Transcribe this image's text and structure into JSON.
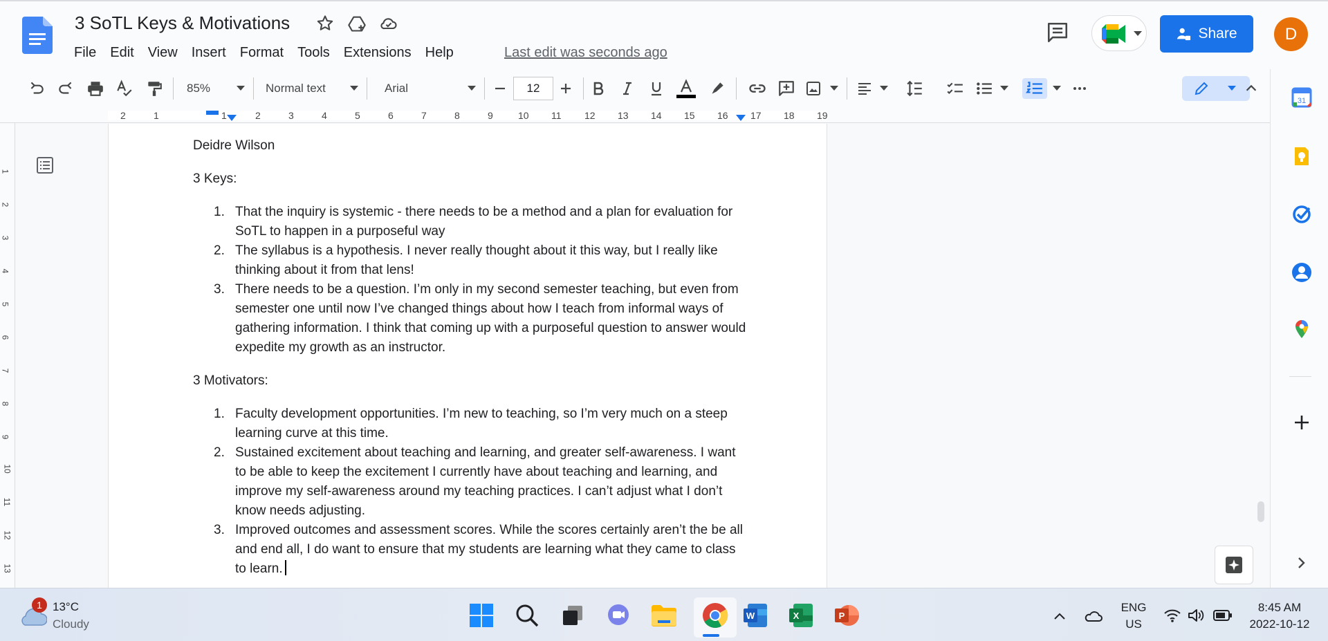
{
  "app": {
    "title": "3 SoTL Keys & Motivations",
    "menu": [
      "File",
      "Edit",
      "View",
      "Insert",
      "Format",
      "Tools",
      "Extensions",
      "Help"
    ],
    "last_edit": "Last edit was seconds ago",
    "share_label": "Share",
    "avatar_initial": "D"
  },
  "toolbar": {
    "zoom": "85%",
    "style": "Normal text",
    "font": "Arial",
    "font_size": "12"
  },
  "ruler": {
    "top_numbers": [
      "2",
      "1",
      "1",
      "2",
      "3",
      "4",
      "5",
      "6",
      "7",
      "8",
      "9",
      "10",
      "11",
      "12",
      "13",
      "14",
      "15",
      "16",
      "17",
      "18",
      "19"
    ],
    "left_numbers": [
      "1",
      "2",
      "3",
      "4",
      "5",
      "6",
      "7",
      "8",
      "9",
      "10",
      "11",
      "12",
      "13"
    ]
  },
  "document": {
    "author": "Deidre Wilson",
    "keys_heading": "3 Keys:",
    "keys": [
      "That the inquiry is systemic - there needs to be a method and a plan for evaluation for SoTL to happen in a purposeful way",
      "The syllabus is a hypothesis. I never really thought about it this way, but I really like thinking about it from that lens!",
      "There needs to be a question. I’m only in my second semester teaching, but even from semester one until now I’ve changed things about how I teach from informal ways of gathering information. I think that coming up with a purposeful question to answer would expedite my growth as an instructor."
    ],
    "motivators_heading": "3 Motivators:",
    "motivators": [
      "Faculty development opportunities. I’m new to teaching, so I’m very much on a steep learning curve at this time.",
      "Sustained excitement about teaching and learning, and greater self-awareness. I want to be able to keep the excitement I currently have about teaching and learning, and improve my self-awareness around my teaching practices. I can’t adjust what I don’t know needs adjusting.",
      "Improved outcomes and assessment scores. While the scores certainly aren’t the be all and end all, I do want to ensure that my students are learning what they came to class to learn."
    ],
    "list_numbers": [
      "1.",
      "2.",
      "3."
    ]
  },
  "taskbar": {
    "weather_badge": "1",
    "temperature": "13°C",
    "weather": "Cloudy",
    "language": "ENG",
    "region": "US",
    "time": "8:45 AM",
    "date": "2022-10-12"
  },
  "colors": {
    "accent": "#1a73e8",
    "avatar": "#e8710a",
    "active_button": "#d3e3fd"
  }
}
